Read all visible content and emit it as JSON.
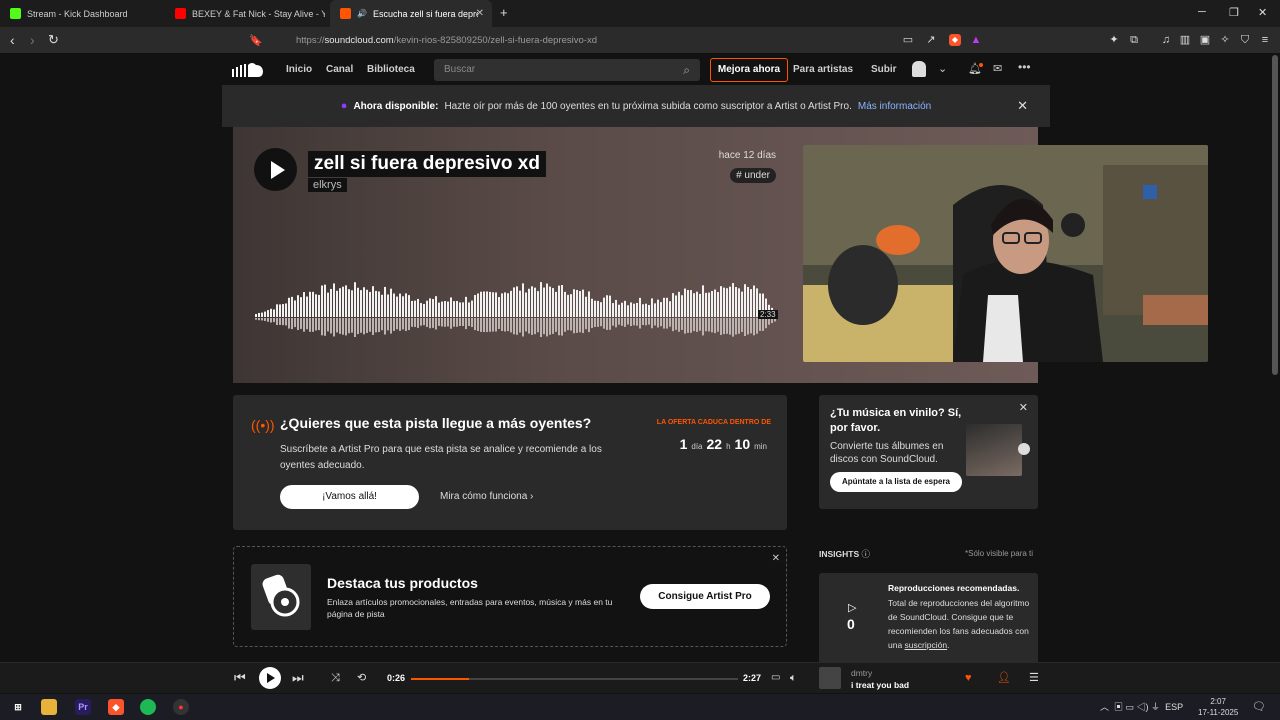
{
  "browser": {
    "tabs": [
      {
        "label": "Stream - Kick Dashboard",
        "favicon_color": "#53fc18"
      },
      {
        "label": "BEXEY & Fat Nick - Stay Alive - YouTu",
        "favicon_color": "#ff0000"
      },
      {
        "label": "Escucha zell si fuera depresivo",
        "favicon_color": "#ff5500"
      }
    ],
    "url_prefix": "https://",
    "url_host": "soundcloud.com",
    "url_path": "/kevin-rios-825809250/zell-si-fuera-depresivo-xd"
  },
  "sc_header": {
    "nav": [
      "Inicio",
      "Canal",
      "Biblioteca"
    ],
    "search_placeholder": "Buscar",
    "upgrade": "Mejora ahora",
    "for_artists": "Para artistas",
    "upload": "Subir"
  },
  "banner": {
    "emphasis": "Ahora disponible:",
    "text": "Hazte oír por más de 100 oyentes en tu próxima subida como suscriptor a Artist o Artist Pro.",
    "link": "Más información"
  },
  "track": {
    "title": "zell si fuera depresivo xd",
    "artist": "elkrys",
    "posted": "hace 12 días",
    "tag": "# under",
    "duration": "2:33"
  },
  "promo": {
    "title": "¿Quieres que esta pista llegue a más oyentes?",
    "body": "Suscríbete a Artist Pro para que esta pista se analice y recomiende a los oyentes adecuado.",
    "button": "¡Vamos allá!",
    "link": "Mira cómo funciona",
    "offer_label": "LA OFERTA CADUCA DENTRO DE",
    "days": "1",
    "days_unit": "día",
    "hours": "22",
    "hours_unit": "h",
    "minutes": "10",
    "minutes_unit": "min"
  },
  "vinyl": {
    "title": "¿Tu música en vinilo? Sí, por favor.",
    "body": "Convierte tus álbumes en discos con SoundCloud.",
    "button": "Apúntate a la lista de espera"
  },
  "destaca": {
    "title": "Destaca tus productos",
    "body": "Enlaza artículos promocionales, entradas para eventos, música y más en tu página de pista",
    "button": "Consigue Artist Pro"
  },
  "insights": {
    "label": "INSIGHTS",
    "note": "*Sólo visible para ti",
    "count": "0",
    "title": "Reproducciones recomendadas.",
    "body_start": "Total de reproducciones del algoritmo de SoundCloud. Consigue que te recomienden los fans adecuados con una ",
    "body_link": "suscripción",
    "body_end": "."
  },
  "player": {
    "elapsed": "0:26",
    "total": "2:27",
    "progress": 0.177,
    "artist": "dmtry",
    "track": "i treat you bad"
  },
  "taskbar": {
    "lang": "ESP",
    "time": "2:07",
    "date": "17-11-2025"
  },
  "colors": {
    "accent": "#ff5500",
    "link": "#8ab4ff"
  }
}
